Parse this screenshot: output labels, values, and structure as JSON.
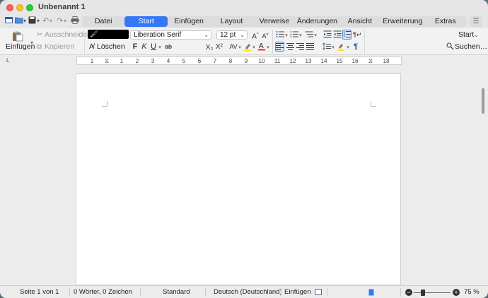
{
  "window": {
    "title": "Unbenannt 1"
  },
  "tabs": [
    {
      "label": "Datei"
    },
    {
      "label": "Start"
    },
    {
      "label": "Einfügen"
    },
    {
      "label": "Layout"
    },
    {
      "label": "Verweise"
    },
    {
      "label": "Änderungen"
    },
    {
      "label": "Ansicht"
    },
    {
      "label": "Erweiterung"
    },
    {
      "label": "Extras"
    }
  ],
  "active_tab": "Start",
  "ribbon": {
    "paste_label": "Einfügen",
    "cut_label": "Ausschneiden",
    "copy_label": "Kopieren",
    "clear_label": "Löschen",
    "font_name": "Liberation Serif",
    "font_size": "12 pt",
    "bold": "F",
    "italic": "K",
    "underline": "U",
    "strike": "ab",
    "subscript": "X₂",
    "superscript": "X²",
    "style_label": "Start",
    "find_label": "Suchen…"
  },
  "ruler": {
    "numbers": [
      "1",
      "1",
      "2",
      "3",
      "4",
      "5",
      "6",
      "7",
      "8",
      "9",
      "10",
      "11",
      "12",
      "13",
      "14",
      "15",
      "16",
      "17",
      "18"
    ]
  },
  "status": {
    "page": "Seite 1 von 1",
    "words": "0 Wörter, 0 Zeichen",
    "style": "Standard",
    "language": "Deutsch (Deutschland)",
    "mode": "Einfügen",
    "zoom": "75 %",
    "zoom_level": 0.25
  },
  "colors": {
    "accent": "#3478f6",
    "font_color": "#e0332c",
    "highlight": "#ffe01a"
  },
  "icons": [
    "paste-icon",
    "cut-icon",
    "copy-icon",
    "clear-format-icon",
    "new-doc-icon",
    "open-icon",
    "save-icon",
    "undo-icon",
    "redo-icon",
    "print-icon",
    "bullets-icon",
    "numbering-icon",
    "outline-icon",
    "align-left-icon",
    "align-center-icon",
    "align-right-icon",
    "justify-icon",
    "line-spacing-icon",
    "paragraph-mark-icon"
  ]
}
